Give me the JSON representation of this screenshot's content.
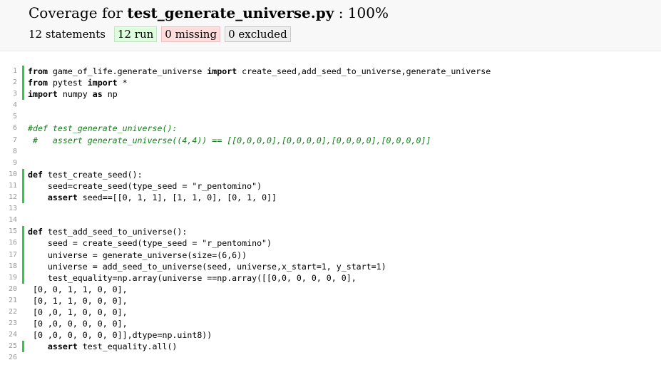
{
  "header": {
    "title_prefix": "Coverage for ",
    "filename": "test_generate_universe.py",
    "title_suffix": " : 100%",
    "statements_text": "12 statements",
    "buttons": {
      "run": "12 run",
      "missing": "0 missing",
      "excluded": "0 excluded"
    }
  },
  "colors": {
    "run_marker": "#2ecc40",
    "run_button_bg": "#ddffdd",
    "missing_button_bg": "#ffdddd",
    "excluded_button_bg": "#eeeeee",
    "comment_text": "#14801a",
    "line_number_text": "#999999"
  },
  "source_lines": [
    {
      "n": "1",
      "run": true,
      "tokens": [
        {
          "t": "from",
          "k": "k"
        },
        {
          "t": " game_of_life.generate_universe "
        },
        {
          "t": "import",
          "k": "k"
        },
        {
          "t": " create_seed,add_seed_to_universe,generate_universe"
        }
      ]
    },
    {
      "n": "2",
      "run": true,
      "tokens": [
        {
          "t": "from",
          "k": "k"
        },
        {
          "t": " pytest "
        },
        {
          "t": "import",
          "k": "k"
        },
        {
          "t": " *"
        }
      ]
    },
    {
      "n": "3",
      "run": true,
      "tokens": [
        {
          "t": "import",
          "k": "k"
        },
        {
          "t": " numpy "
        },
        {
          "t": "as",
          "k": "k"
        },
        {
          "t": " np"
        }
      ]
    },
    {
      "n": "4",
      "run": false,
      "tokens": []
    },
    {
      "n": "5",
      "run": false,
      "tokens": []
    },
    {
      "n": "6",
      "run": false,
      "tokens": [
        {
          "t": "#def test_generate_universe():",
          "k": "c"
        }
      ]
    },
    {
      "n": "7",
      "run": false,
      "tokens": [
        {
          "t": " #   assert generate_universe((4,4)) == [[0,0,0,0],[0,0,0,0],[0,0,0,0],[0,0,0,0]]",
          "k": "c"
        }
      ]
    },
    {
      "n": "8",
      "run": false,
      "tokens": []
    },
    {
      "n": "9",
      "run": false,
      "tokens": []
    },
    {
      "n": "10",
      "run": true,
      "tokens": [
        {
          "t": "def",
          "k": "k"
        },
        {
          "t": " test_create_seed():"
        }
      ]
    },
    {
      "n": "11",
      "run": true,
      "tokens": [
        {
          "t": "    seed=create_seed(type_seed = \"r_pentomino\")"
        }
      ]
    },
    {
      "n": "12",
      "run": true,
      "tokens": [
        {
          "t": "    "
        },
        {
          "t": "assert",
          "k": "k"
        },
        {
          "t": " seed==[[0, 1, 1], [1, 1, 0], [0, 1, 0]]"
        }
      ]
    },
    {
      "n": "13",
      "run": false,
      "tokens": []
    },
    {
      "n": "14",
      "run": false,
      "tokens": []
    },
    {
      "n": "15",
      "run": true,
      "tokens": [
        {
          "t": "def",
          "k": "k"
        },
        {
          "t": " test_add_seed_to_universe():"
        }
      ]
    },
    {
      "n": "16",
      "run": true,
      "tokens": [
        {
          "t": "    seed = create_seed(type_seed = \"r_pentomino\")"
        }
      ]
    },
    {
      "n": "17",
      "run": true,
      "tokens": [
        {
          "t": "    universe = generate_universe(size=(6,6))"
        }
      ]
    },
    {
      "n": "18",
      "run": true,
      "tokens": [
        {
          "t": "    universe = add_seed_to_universe(seed, universe,x_start=1, y_start=1)"
        }
      ]
    },
    {
      "n": "19",
      "run": true,
      "tokens": [
        {
          "t": "    test_equality=np.array(universe ==np.array([[0,0, 0, 0, 0, 0],"
        }
      ]
    },
    {
      "n": "20",
      "run": false,
      "tokens": [
        {
          "t": " [0, 0, 1, 1, 0, 0],"
        }
      ]
    },
    {
      "n": "21",
      "run": false,
      "tokens": [
        {
          "t": " [0, 1, 1, 0, 0, 0],"
        }
      ]
    },
    {
      "n": "22",
      "run": false,
      "tokens": [
        {
          "t": " [0 ,0, 1, 0, 0, 0],"
        }
      ]
    },
    {
      "n": "23",
      "run": false,
      "tokens": [
        {
          "t": " [0 ,0, 0, 0, 0, 0],"
        }
      ]
    },
    {
      "n": "24",
      "run": false,
      "tokens": [
        {
          "t": " [0 ,0, 0, 0, 0, 0]],dtype=np.uint8))"
        }
      ]
    },
    {
      "n": "25",
      "run": true,
      "tokens": [
        {
          "t": "    "
        },
        {
          "t": "assert",
          "k": "k"
        },
        {
          "t": " test_equality.all()"
        }
      ]
    },
    {
      "n": "26",
      "run": false,
      "tokens": []
    }
  ]
}
